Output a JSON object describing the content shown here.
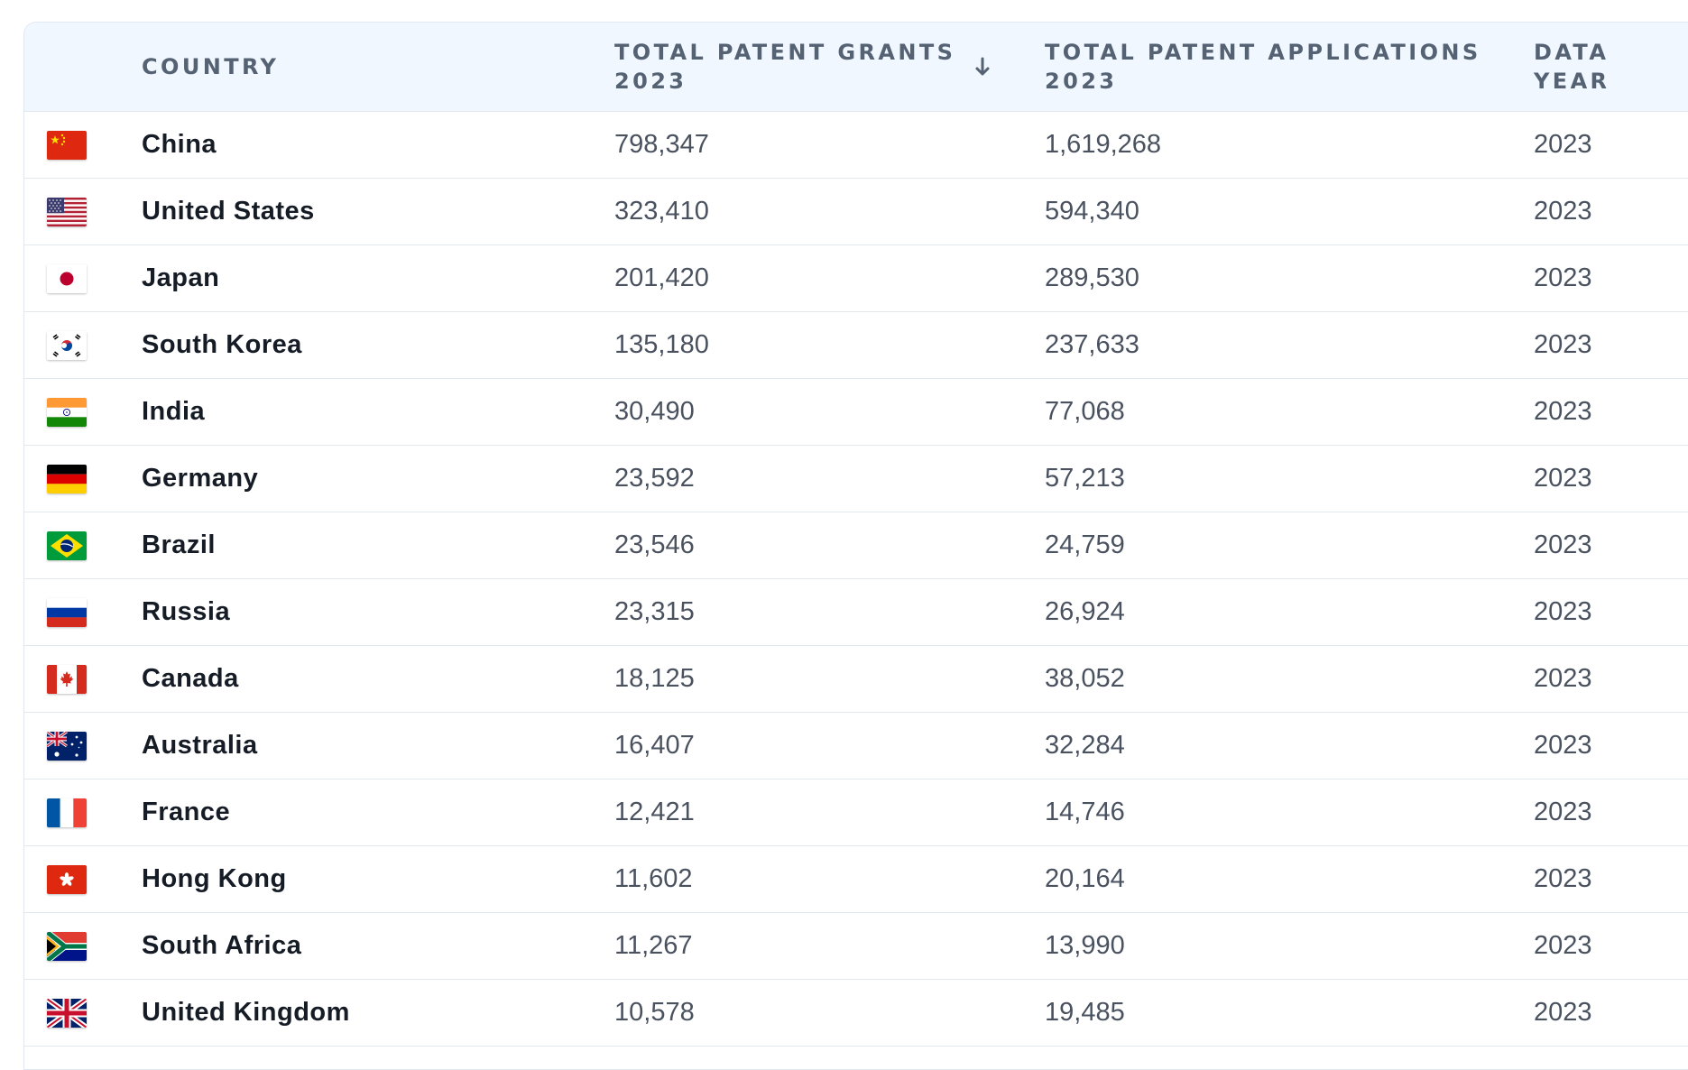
{
  "table": {
    "headers": {
      "country": "COUNTRY",
      "grants_line1": "TOTAL PATENT GRANTS",
      "grants_line2": "2023",
      "apps_line1": "TOTAL PATENT APPLICATIONS",
      "apps_line2": "2023",
      "year_line1": "DATA",
      "year_line2": "YEAR"
    },
    "sort": {
      "column": "grants",
      "direction": "descending",
      "icon": "arrow-down-icon"
    },
    "rows": [
      {
        "flag": "china-flag-icon",
        "country": "China",
        "grants": "798,347",
        "applications": "1,619,268",
        "year": "2023"
      },
      {
        "flag": "united-states-flag-icon",
        "country": "United States",
        "grants": "323,410",
        "applications": "594,340",
        "year": "2023"
      },
      {
        "flag": "japan-flag-icon",
        "country": "Japan",
        "grants": "201,420",
        "applications": "289,530",
        "year": "2023"
      },
      {
        "flag": "south-korea-flag-icon",
        "country": "South Korea",
        "grants": "135,180",
        "applications": "237,633",
        "year": "2023"
      },
      {
        "flag": "india-flag-icon",
        "country": "India",
        "grants": "30,490",
        "applications": "77,068",
        "year": "2023"
      },
      {
        "flag": "germany-flag-icon",
        "country": "Germany",
        "grants": "23,592",
        "applications": "57,213",
        "year": "2023"
      },
      {
        "flag": "brazil-flag-icon",
        "country": "Brazil",
        "grants": "23,546",
        "applications": "24,759",
        "year": "2023"
      },
      {
        "flag": "russia-flag-icon",
        "country": "Russia",
        "grants": "23,315",
        "applications": "26,924",
        "year": "2023"
      },
      {
        "flag": "canada-flag-icon",
        "country": "Canada",
        "grants": "18,125",
        "applications": "38,052",
        "year": "2023"
      },
      {
        "flag": "australia-flag-icon",
        "country": "Australia",
        "grants": "16,407",
        "applications": "32,284",
        "year": "2023"
      },
      {
        "flag": "france-flag-icon",
        "country": "France",
        "grants": "12,421",
        "applications": "14,746",
        "year": "2023"
      },
      {
        "flag": "hong-kong-flag-icon",
        "country": "Hong Kong",
        "grants": "11,602",
        "applications": "20,164",
        "year": "2023"
      },
      {
        "flag": "south-africa-flag-icon",
        "country": "South Africa",
        "grants": "11,267",
        "applications": "13,990",
        "year": "2023"
      },
      {
        "flag": "united-kingdom-flag-icon",
        "country": "United Kingdom",
        "grants": "10,578",
        "applications": "19,485",
        "year": "2023"
      }
    ]
  },
  "colors": {
    "header_bg": "#f0f7fe",
    "header_text": "#556273",
    "country_text": "#161c26",
    "value_text": "#4a5260",
    "border": "#e2e8f0"
  }
}
